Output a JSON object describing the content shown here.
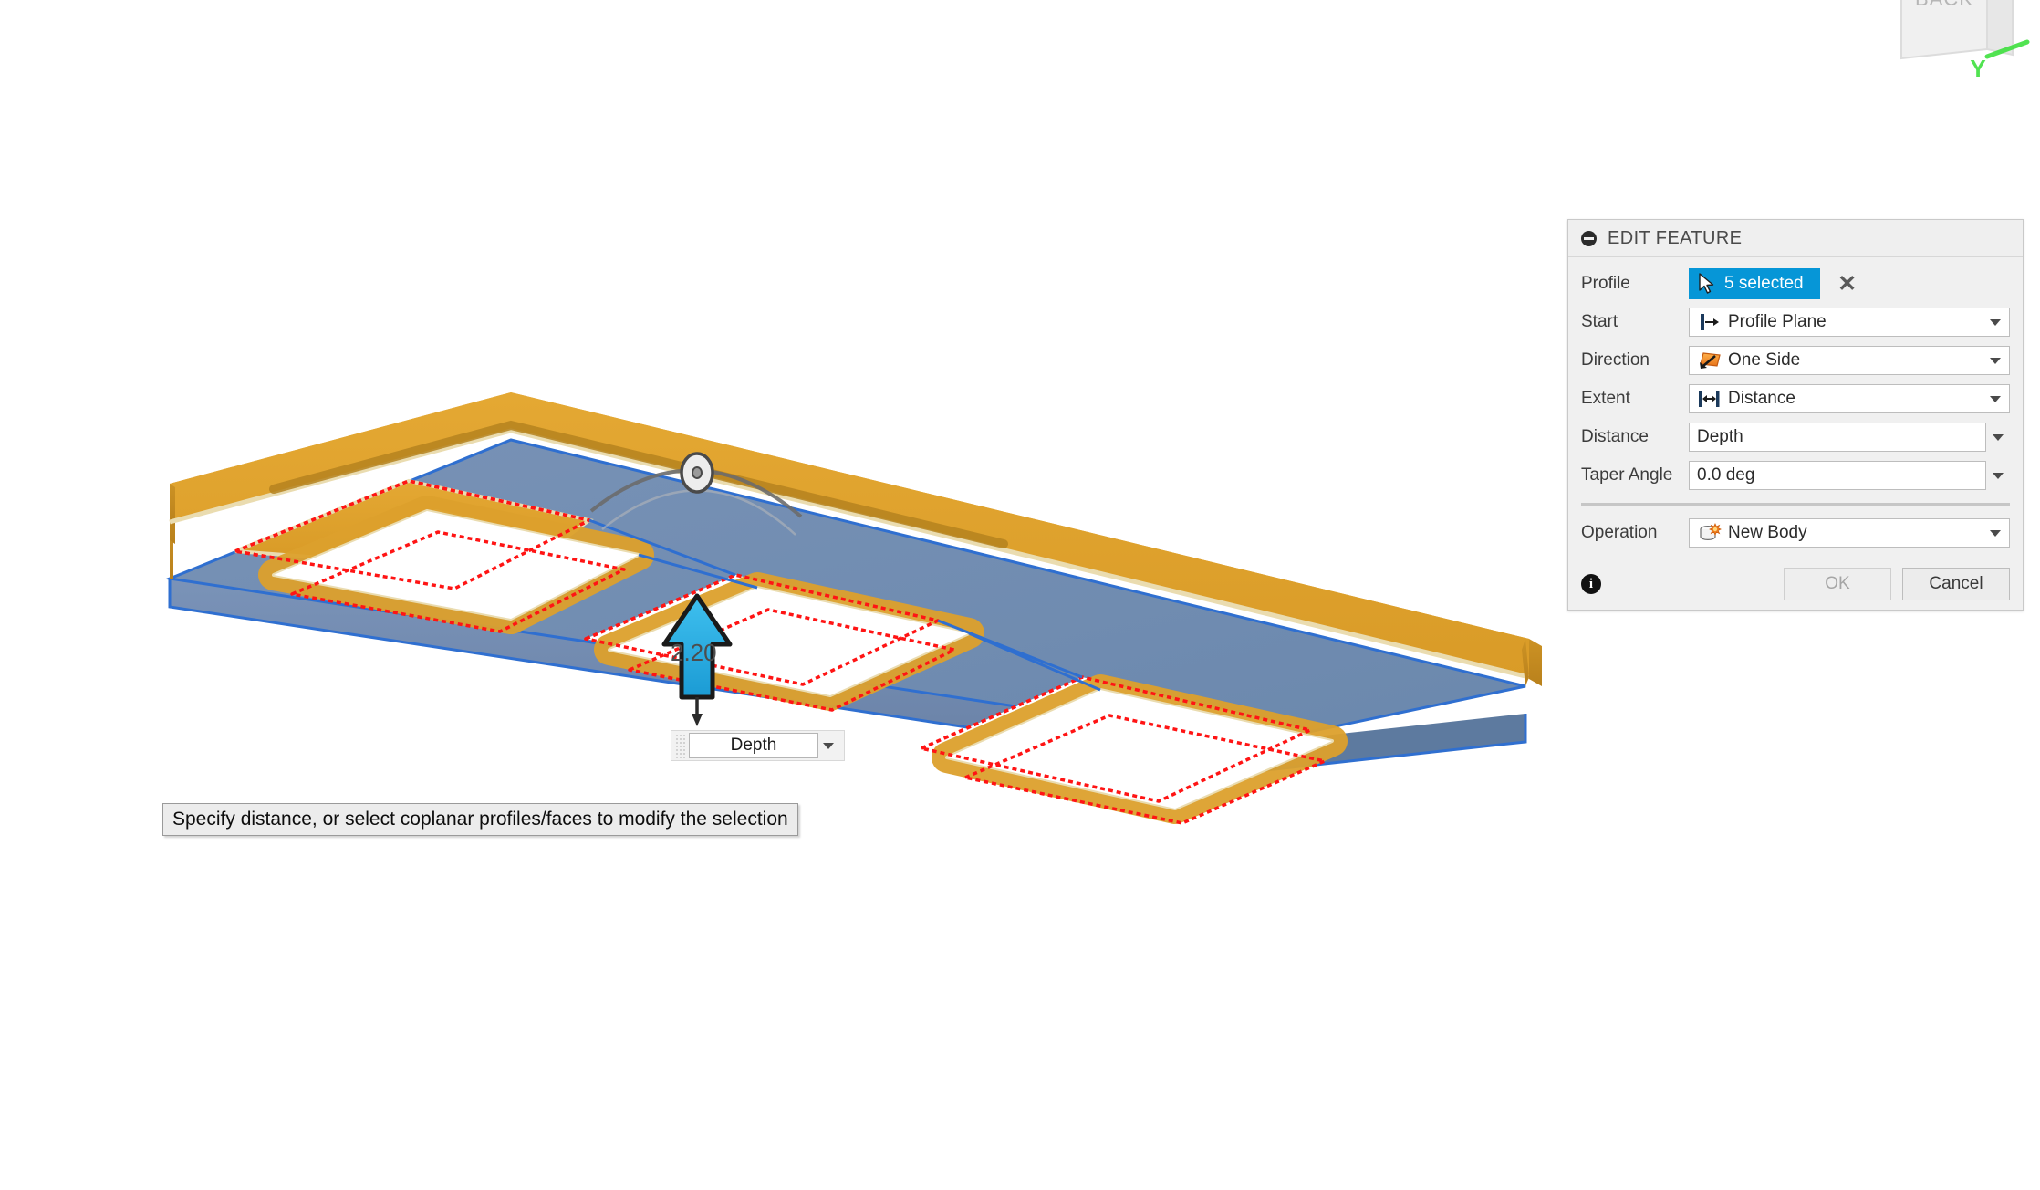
{
  "app": {
    "viewcube_label": "BACK",
    "axis_label": "Y"
  },
  "viewport": {
    "dimension_value": "2.20",
    "depth_widget": {
      "value": "Depth",
      "dropdown_icon": "chevron-down-icon",
      "grip_icon": "drag-grip-icon"
    },
    "manipulator_arrow_icon": "extrude-direction-arrow-icon",
    "taper_handle_icon": "taper-angle-rotate-handle-icon",
    "colors": {
      "body_top": "#e0a32e",
      "body_side": "#c98f24",
      "slab_fill": "#6f8cb0",
      "slab_edge": "#2f6fd0",
      "profile_outline": "#ff1414",
      "arrow_fill": "#29abe2",
      "arrow_stroke": "#1a1a1a"
    }
  },
  "status_tooltip": {
    "text": "Specify distance, or select coplanar profiles/faces to modify the selection"
  },
  "dialog": {
    "title": "EDIT FEATURE",
    "collapse_icon": "collapse-minus-icon",
    "accent_color": "#0696d7",
    "rows": [
      {
        "label": "Profile",
        "type": "selection",
        "value": "5 selected",
        "icon": "cursor-arrow-icon",
        "clear_icon": "close-x-icon"
      },
      {
        "label": "Start",
        "type": "combo",
        "value": "Profile Plane",
        "icon": "profile-plane-icon"
      },
      {
        "label": "Direction",
        "type": "combo",
        "value": "One Side",
        "icon": "one-side-direction-icon"
      },
      {
        "label": "Extent",
        "type": "combo",
        "value": "Distance",
        "icon": "distance-extent-icon"
      },
      {
        "label": "Distance",
        "type": "text-combo",
        "value": "Depth"
      },
      {
        "label": "Taper Angle",
        "type": "text-combo",
        "value": "0.0 deg"
      },
      {
        "label": "Operation",
        "type": "combo",
        "value": "New Body",
        "icon": "new-body-icon"
      }
    ],
    "footer": {
      "info_icon": "info-icon",
      "ok_label": "OK",
      "ok_enabled": false,
      "cancel_label": "Cancel"
    }
  }
}
